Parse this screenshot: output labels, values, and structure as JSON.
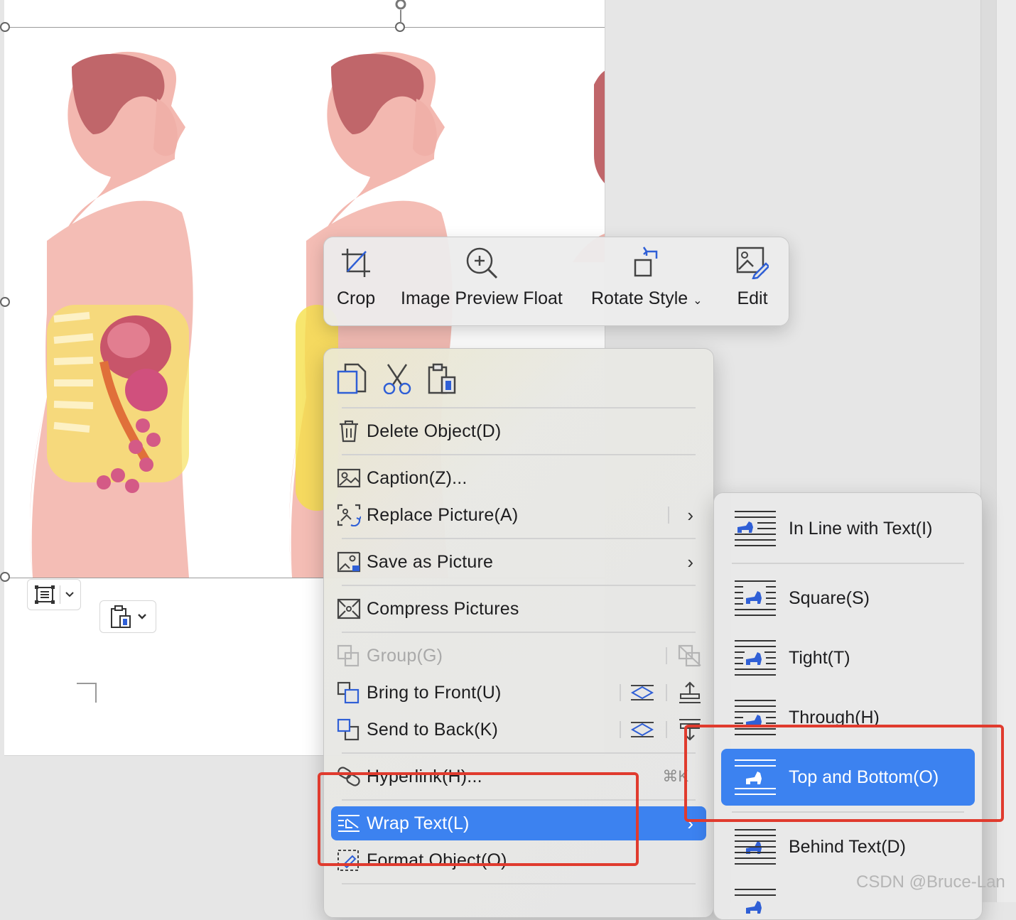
{
  "float_toolbar": {
    "crop": "Crop",
    "image_preview_float": "Image Preview Float",
    "rotate_style": "Rotate Style",
    "edit": "Edit"
  },
  "context_menu": {
    "delete_object": "Delete Object(D)",
    "caption": "Caption(Z)...",
    "replace_picture": "Replace Picture(A)",
    "save_as_picture": "Save as Picture",
    "compress_pictures": "Compress Pictures",
    "group": "Group(G)",
    "bring_to_front": "Bring to Front(U)",
    "send_to_back": "Send to Back(K)",
    "hyperlink": "Hyperlink(H)...",
    "hyperlink_shortcut": "⌘K",
    "wrap_text": "Wrap Text(L)",
    "format_object": "Format Object(O)"
  },
  "wrap_submenu": {
    "in_line": "In Line with Text(I)",
    "square": "Square(S)",
    "tight": "Tight(T)",
    "through": "Through(H)",
    "top_and_bottom": "Top and Bottom(O)",
    "behind_text": "Behind Text(D)"
  },
  "watermark": "CSDN @Bruce-Lan",
  "colors": {
    "accent": "#3c82f0",
    "highlight": "#e03b2e",
    "icon_blue": "#2f5fd6"
  },
  "icons": {
    "crop": "crop-icon",
    "zoom": "zoom-in-icon",
    "rotate": "rotate-icon",
    "edit": "image-edit-icon",
    "wrap": "wrap-text-icon"
  }
}
